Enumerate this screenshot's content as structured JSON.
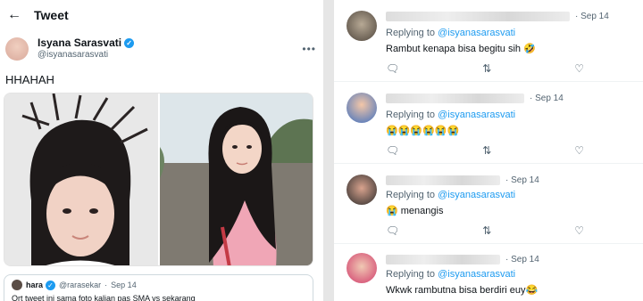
{
  "left": {
    "header": {
      "back_icon": "arrow-left-icon",
      "title": "Tweet"
    },
    "tweet": {
      "author_name": "Isyana Sarasvati",
      "author_handle": "@isyanasarasvati",
      "more_icon": "more-horizontal-icon",
      "text": "HHAHAH",
      "quote": {
        "name": "hara",
        "handle": "@rarasekar",
        "time": "Sep 14",
        "text": "Ort tweet ini sama foto kalian pas SMA vs sekarang"
      }
    }
  },
  "replies": [
    {
      "time": "Sep 14",
      "replying_prefix": "Replying to",
      "mention": "@isyanasarasvati",
      "text": "Rambut kenapa bisa begitu sih 🤣"
    },
    {
      "time": "Sep 14",
      "replying_prefix": "Replying to",
      "mention": "@isyanasarasvati",
      "text": "😭😭😭😭😭😭"
    },
    {
      "time": "Sep 14",
      "replying_prefix": "Replying to",
      "mention": "@isyanasarasvati",
      "text": "😭 menangis"
    },
    {
      "time": "Sep 14",
      "replying_prefix": "Replying to",
      "mention": "@isyanasarasvati",
      "text": "Wkwk rambutna bisa berdiri euy😂"
    }
  ],
  "actions": {
    "reply_icon": "comment-icon",
    "retweet_icon": "retweet-icon",
    "like_icon": "heart-icon"
  },
  "colors": {
    "accent": "#1d9bf0",
    "text": "#0f1419",
    "muted": "#536471"
  }
}
